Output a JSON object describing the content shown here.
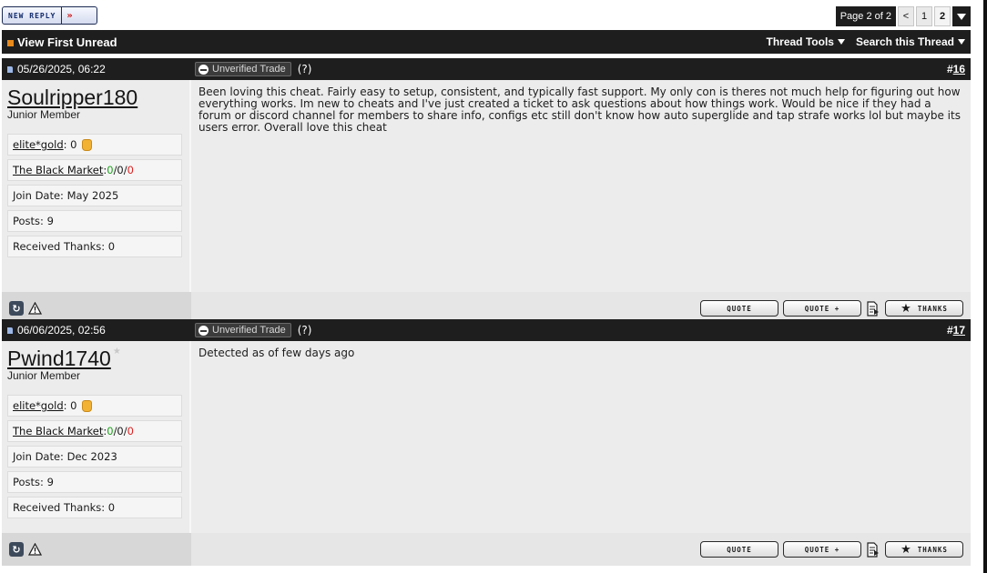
{
  "toolbar": {
    "new_reply_label": "NEW REPLY",
    "new_reply_arrow": "»",
    "pager": {
      "label": "Page 2 of 2",
      "prev": "<",
      "pages": [
        "1",
        "2"
      ],
      "current": "2"
    }
  },
  "threadbar": {
    "view_first_unread": "View First Unread",
    "thread_tools": "Thread Tools",
    "search_thread": "Search this Thread"
  },
  "posts": [
    {
      "date": "05/26/2025, 06:22",
      "badge": "Unverified Trade",
      "help": "(?)",
      "number_prefix": "#",
      "number": "16",
      "username": "Soulripper180",
      "user_title": "Junior Member",
      "gold_label": "elite*gold",
      "gold_value": ": 0",
      "market_label": "The Black Market",
      "market_sep": ": ",
      "market_pos": "0",
      "market_neu": "/0/",
      "market_neg": "0",
      "join_date": "Join Date: May 2025",
      "posts": "Posts: 9",
      "thanks_received": "Received Thanks: 0",
      "message": "Been loving this cheat. Fairly easy to setup, consistent, and typically fast support. My only con is theres not much help for figuring out how everything works. Im new to cheats and I've just created a ticket to ask questions about how things work. Would be nice if they had a forum or discord channel for members to share info, configs etc still don't know how auto superglide and tap strafe works lol but maybe its users error. Overall love this cheat"
    },
    {
      "date": "06/06/2025, 02:56",
      "badge": "Unverified Trade",
      "help": "(?)",
      "number_prefix": "#",
      "number": "17",
      "username": "Pwind1740",
      "user_title": "Junior Member",
      "gold_label": "elite*gold",
      "gold_value": ": 0",
      "market_label": "The Black Market",
      "market_sep": ": ",
      "market_pos": "0",
      "market_neu": "/0/",
      "market_neg": "0",
      "join_date": "Join Date: Dec 2023",
      "posts": "Posts: 9",
      "thanks_received": "Received Thanks: 0",
      "message": "Detected as of few days ago"
    }
  ],
  "buttons": {
    "quote": "QUOTE",
    "quote_plus": "QUOTE +",
    "thanks": "THANKS"
  },
  "colors": {
    "bar": "#1e1e1e",
    "post_bg": "#ececec",
    "positive": "#20a020",
    "negative": "#e02020",
    "accent": "#e88a1c"
  }
}
